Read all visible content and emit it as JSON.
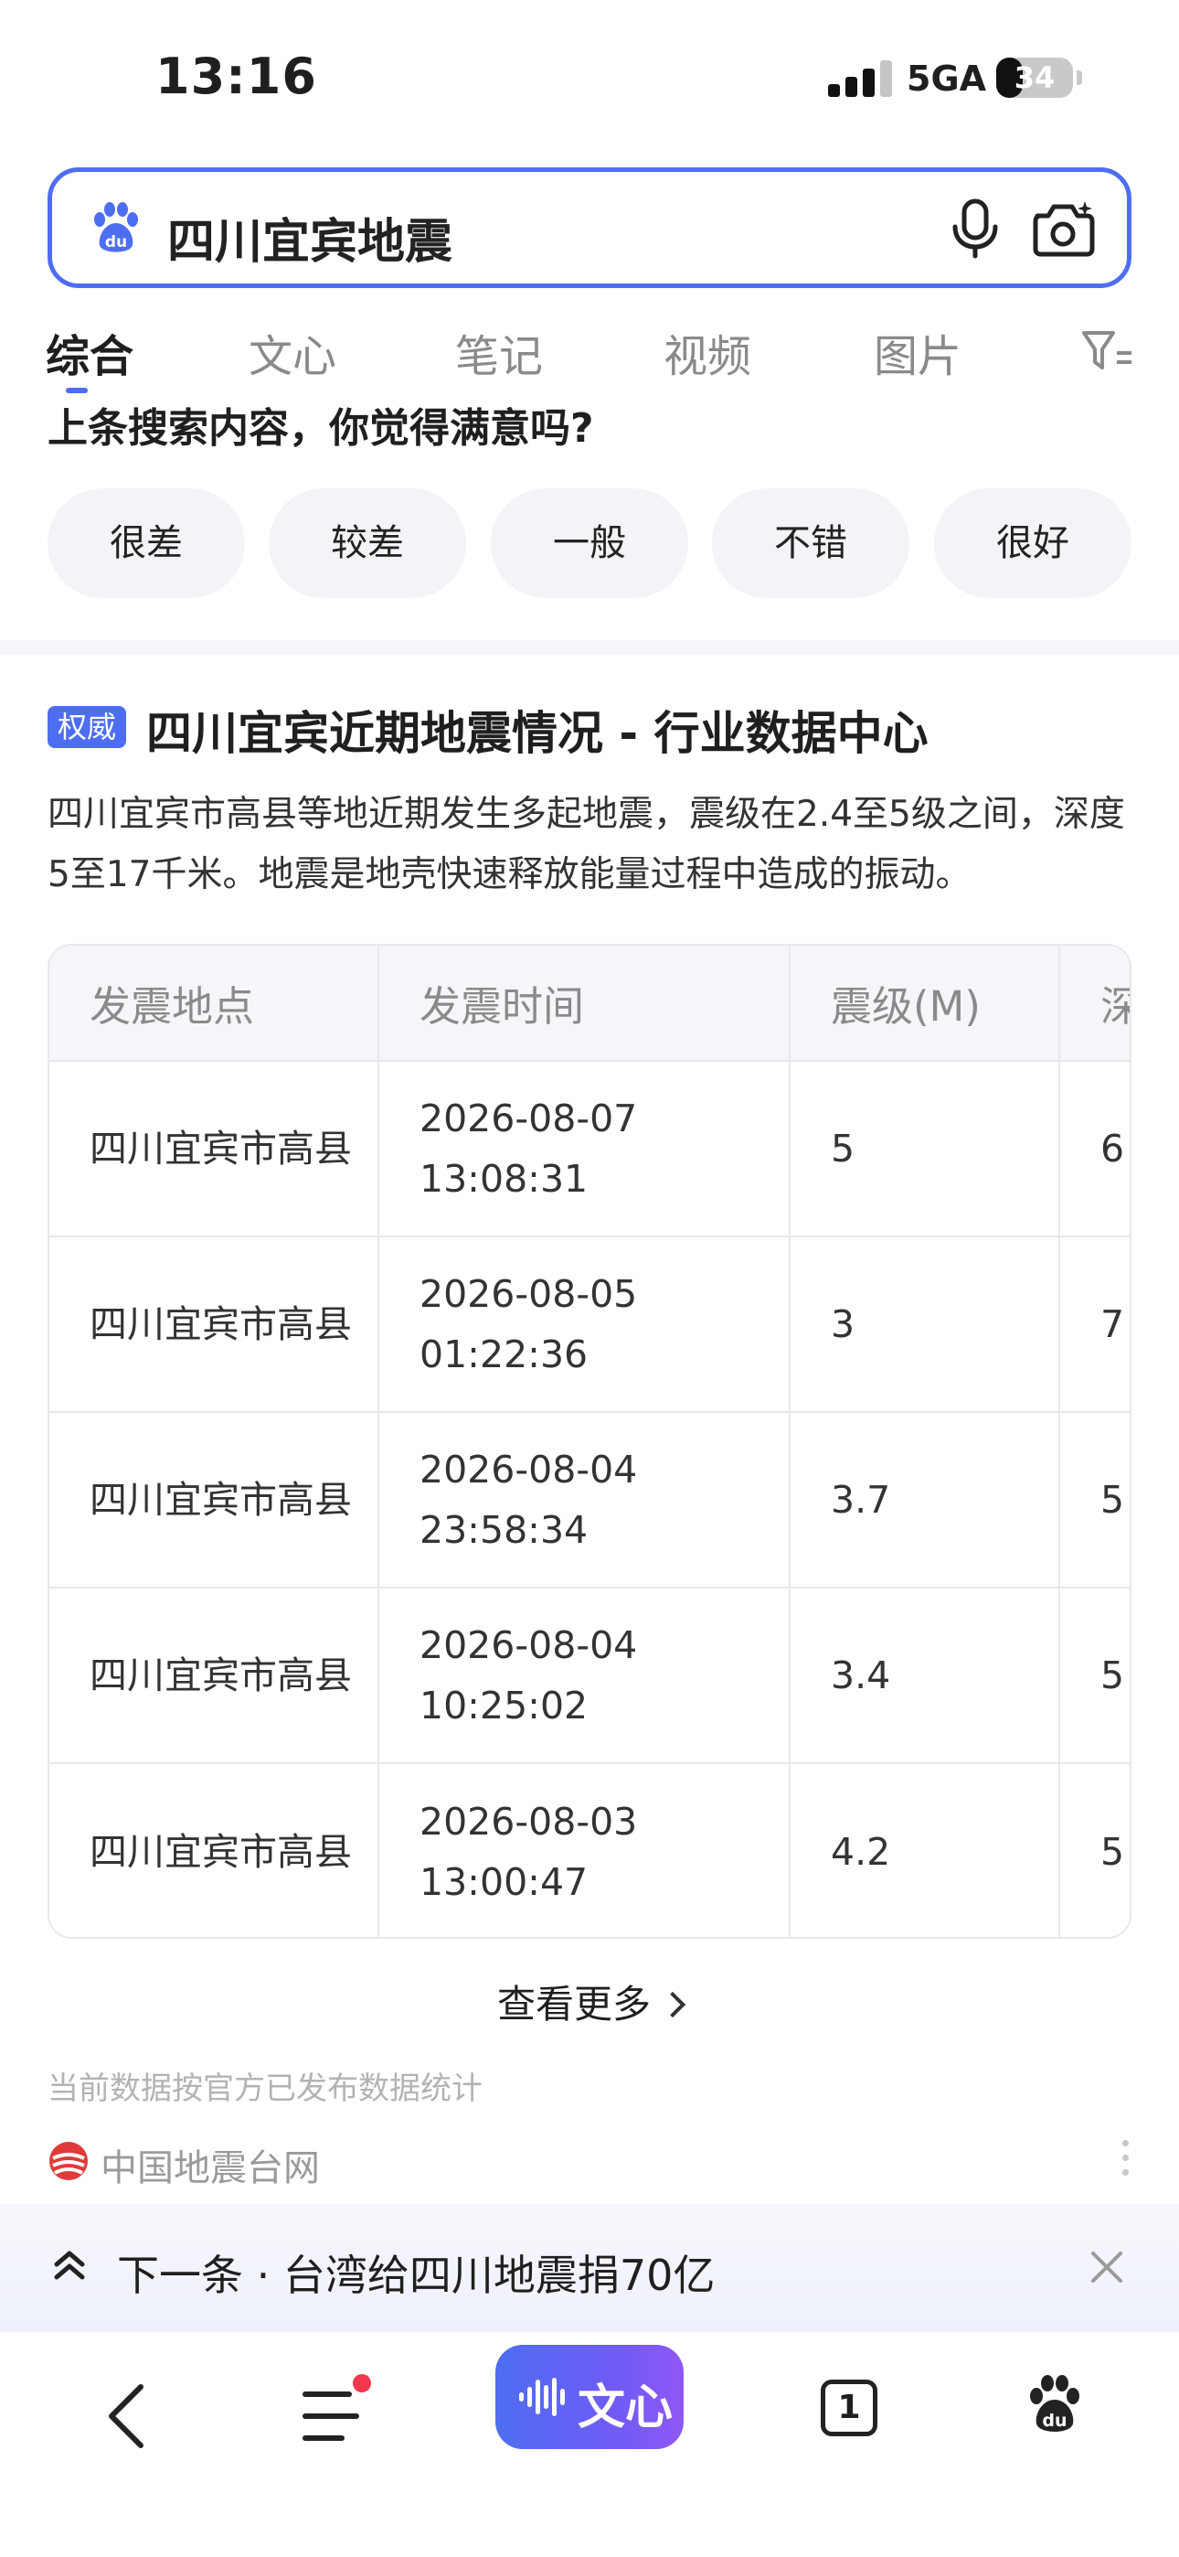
{
  "status_bar": {
    "time": "13:16",
    "network": "5GA",
    "battery": "34",
    "battery_level": 0.34
  },
  "search": {
    "query": "四川宜宾地震"
  },
  "tabs": [
    {
      "label": "综合",
      "active": true
    },
    {
      "label": "文心",
      "active": false
    },
    {
      "label": "笔记",
      "active": false
    },
    {
      "label": "视频",
      "active": false
    },
    {
      "label": "图片",
      "active": false
    }
  ],
  "feedback": {
    "question": "上条搜索内容，你觉得满意吗?",
    "options": [
      "很差",
      "较差",
      "一般",
      "不错",
      "很好"
    ]
  },
  "card": {
    "badge": "权威",
    "title": "四川宜宾近期地震情况 - 行业数据中心",
    "description": "四川宜宾市高县等地近期发生多起地震，震级在2.4至5级之间，深度5至17千米。地震是地壳快速释放能量过程中造成的振动。",
    "table": {
      "headers": [
        "发震地点",
        "发震时间",
        "震级(M)",
        "深"
      ],
      "rows": [
        [
          "四川宜宾市高县",
          "2026-08-07 13:08:31",
          "5",
          "6"
        ],
        [
          "四川宜宾市高县",
          "2026-08-05 01:22:36",
          "3",
          "7"
        ],
        [
          "四川宜宾市高县",
          "2026-08-04 23:58:34",
          "3.7",
          "5"
        ],
        [
          "四川宜宾市高县",
          "2026-08-04 10:25:02",
          "3.4",
          "5"
        ],
        [
          "四川宜宾市高县",
          "2026-08-03 13:00:47",
          "4.2",
          "5"
        ]
      ]
    },
    "see_more": "查看更多",
    "note": "当前数据按官方已发布数据统计",
    "source": "中国地震台网"
  },
  "next_banner": {
    "text": "下一条 · 台湾给四川地震捐70亿"
  },
  "bottom_nav": {
    "wenxin_label": "文心",
    "tab_count": "1"
  }
}
